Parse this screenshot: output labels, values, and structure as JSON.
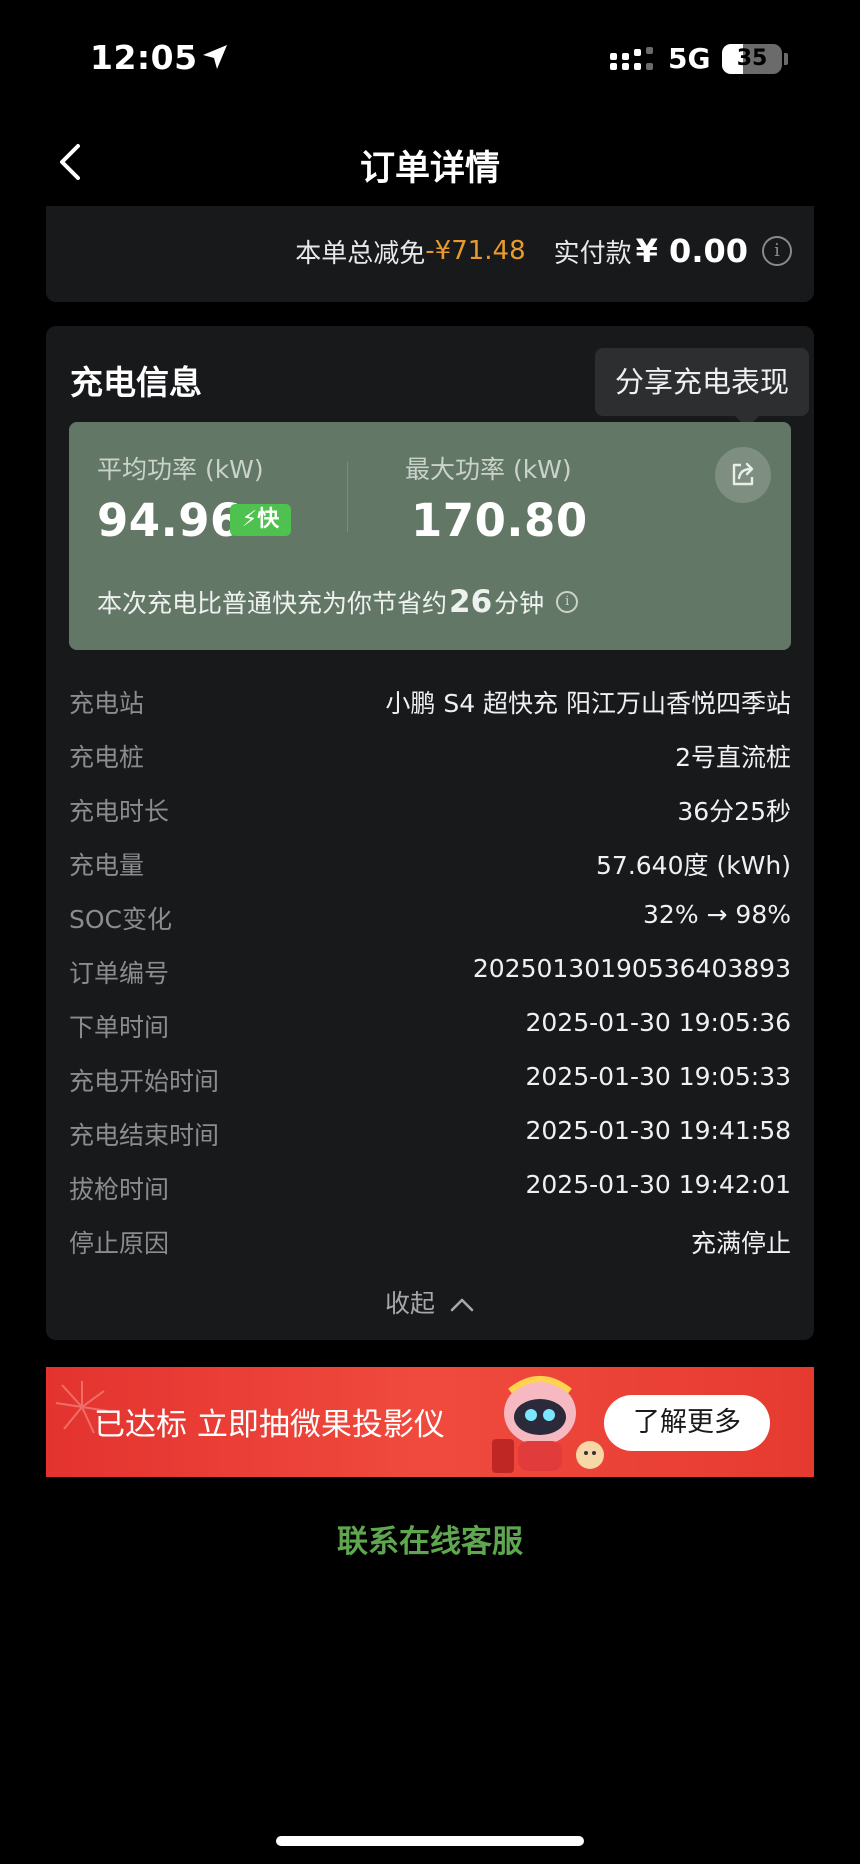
{
  "status_bar": {
    "time": "12:05",
    "network": "5G",
    "battery": "35",
    "battery_level": 0.35
  },
  "nav": {
    "title": "订单详情"
  },
  "payment": {
    "discount_label": "本单总减免",
    "discount_value": "-¥71.48",
    "paid_label": "实付款",
    "paid_value": "¥ 0.00",
    "info_glyph": "i"
  },
  "charge_info": {
    "title": "充电信息",
    "share_tooltip": "分享充电表现",
    "avg_power_label": "平均功率 (kW)",
    "avg_power_value": "94.96",
    "fast_badge": "⚡快",
    "max_power_label": "最大功率 (kW)",
    "max_power_value": "170.80",
    "saving_prefix": "本次充电比普通快充为你节省约",
    "saving_minutes": "26",
    "saving_suffix": "分钟",
    "details": [
      {
        "label": "充电站",
        "value": "小鹏 S4 超快充 阳江万山香悦四季站"
      },
      {
        "label": "充电桩",
        "value": "2号直流桩"
      },
      {
        "label": "充电时长",
        "value": "36分25秒"
      },
      {
        "label": "充电量",
        "value": "57.640度 (kWh)"
      },
      {
        "label": "SOC变化",
        "value": "32% → 98%"
      },
      {
        "label": "订单编号",
        "value": "20250130190536403893"
      },
      {
        "label": "下单时间",
        "value": "2025-01-30 19:05:36"
      },
      {
        "label": "充电开始时间",
        "value": "2025-01-30 19:05:33"
      },
      {
        "label": "充电结束时间",
        "value": "2025-01-30 19:41:58"
      },
      {
        "label": "拔枪时间",
        "value": "2025-01-30 19:42:01"
      },
      {
        "label": "停止原因",
        "value": "充满停止"
      }
    ],
    "collapse_label": "收起"
  },
  "banner": {
    "text": "已达标 立即抽微果投影仪",
    "button": "了解更多"
  },
  "support": {
    "label": "联系在线客服"
  },
  "colors": {
    "background": "#000000",
    "card": "#18191b",
    "panel": "#637767",
    "discount": "#e89a2e",
    "accent_green": "#5fa74e",
    "badge_green": "#4ec14e",
    "banner_red": "#e4332f"
  }
}
